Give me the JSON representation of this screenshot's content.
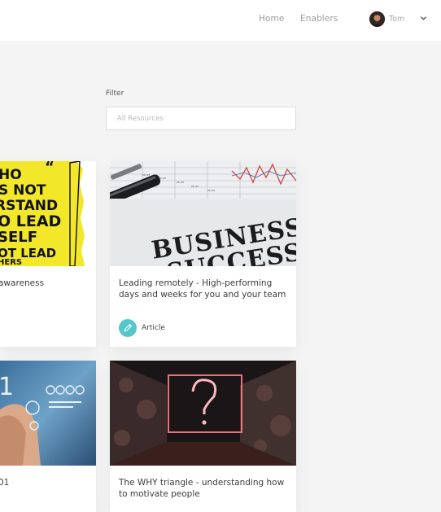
{
  "header": {
    "nav": [
      {
        "label": "Home"
      },
      {
        "label": "Enablers"
      }
    ],
    "user": {
      "name": "Tom"
    }
  },
  "filter": {
    "label": "Filter",
    "placeholder": "All Resources"
  },
  "cards": [
    {
      "title": "awareness",
      "image_text": [
        "HO",
        "S NOT",
        "RSTAND",
        "O LEAD",
        "SELF",
        "OT LEAD",
        "HERS"
      ]
    },
    {
      "title": "Leading remotely - High-performing days and weeks for you and your team",
      "image_text": [
        "BUSINESS",
        "SUCCESS"
      ],
      "type_label": "Article"
    },
    {
      "title": "01"
    },
    {
      "title": "The WHY triangle - understanding how to motivate people"
    }
  ],
  "colors": {
    "accent": "#55c6cc",
    "page_bg": "#f4f4f5",
    "quote_yellow": "#f3e72a"
  },
  "icons": [
    "user-avatar",
    "chevron-down-icon",
    "pencil-icon"
  ]
}
